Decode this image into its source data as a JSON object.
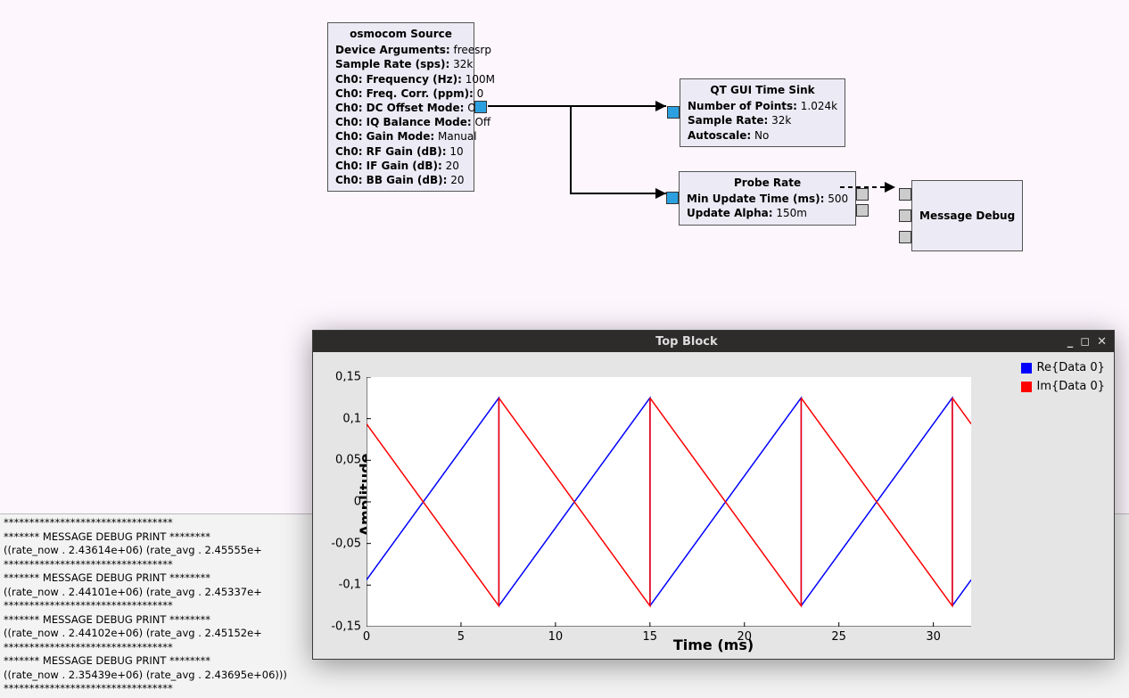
{
  "blocks": {
    "osmo": {
      "title": "osmocom Source",
      "rows": [
        {
          "k": "Device Arguments:",
          "v": "freesrp"
        },
        {
          "k": "Sample Rate (sps):",
          "v": "32k"
        },
        {
          "k": "Ch0: Frequency (Hz):",
          "v": "100M"
        },
        {
          "k": "Ch0: Freq. Corr. (ppm):",
          "v": "0"
        },
        {
          "k": "Ch0: DC Offset Mode:",
          "v": "Off"
        },
        {
          "k": "Ch0: IQ Balance Mode:",
          "v": "Off"
        },
        {
          "k": "Ch0: Gain Mode:",
          "v": "Manual"
        },
        {
          "k": "Ch0: RF Gain (dB):",
          "v": "10"
        },
        {
          "k": "Ch0: IF Gain (dB):",
          "v": "20"
        },
        {
          "k": "Ch0: BB Gain (dB):",
          "v": "20"
        }
      ]
    },
    "sink": {
      "title": "QT GUI Time Sink",
      "rows": [
        {
          "k": "Number of Points:",
          "v": "1.024k"
        },
        {
          "k": "Sample Rate:",
          "v": "32k"
        },
        {
          "k": "Autoscale:",
          "v": "No"
        }
      ]
    },
    "probe": {
      "title": "Probe Rate",
      "rows": [
        {
          "k": "Min Update Time (ms):",
          "v": "500"
        },
        {
          "k": "Update Alpha:",
          "v": "150m"
        }
      ]
    },
    "msgdbg": {
      "title": "Message Debug"
    }
  },
  "console_lines": [
    "*********************************",
    "******* MESSAGE DEBUG PRINT ********",
    "((rate_now . 2.43614e+06) (rate_avg . 2.45555e+",
    "*********************************",
    "******* MESSAGE DEBUG PRINT ********",
    "((rate_now . 2.44101e+06) (rate_avg . 2.45337e+",
    "*********************************",
    "******* MESSAGE DEBUG PRINT ********",
    "((rate_now . 2.44102e+06) (rate_avg . 2.45152e+",
    "*********************************",
    "******* MESSAGE DEBUG PRINT ********",
    "((rate_now . 2.35439e+06) (rate_avg . 2.43695e+06)))",
    "*********************************"
  ],
  "topblock": {
    "title": "Top Block",
    "window_controls": {
      "min": "_",
      "max": "◻",
      "close": "✕"
    }
  },
  "chart_data": {
    "type": "line",
    "title": "",
    "xlabel": "Time (ms)",
    "ylabel": "Amplitude",
    "xlim": [
      0,
      32
    ],
    "ylim": [
      -0.15,
      0.15
    ],
    "xticks": [
      0,
      5,
      10,
      15,
      20,
      25,
      30
    ],
    "yticks": [
      -0.15,
      -0.1,
      -0.05,
      0,
      0.05,
      0.1,
      0.15
    ],
    "ytick_labels": [
      "-0,15",
      "-0,1",
      "-0,05",
      "0",
      "0,05",
      "0,1",
      "0,15"
    ],
    "series": [
      {
        "name": "Re{Data 0}",
        "color": "#0000ff",
        "offset": 0.0,
        "amplitude": 0.125,
        "start_phase": 0.125
      },
      {
        "name": "Im{Data 0}",
        "color": "#ff0000",
        "offset": 0.0,
        "amplitude": -0.125,
        "start_phase": 0.125
      }
    ],
    "sawtooth_period_ms": 8.0
  }
}
